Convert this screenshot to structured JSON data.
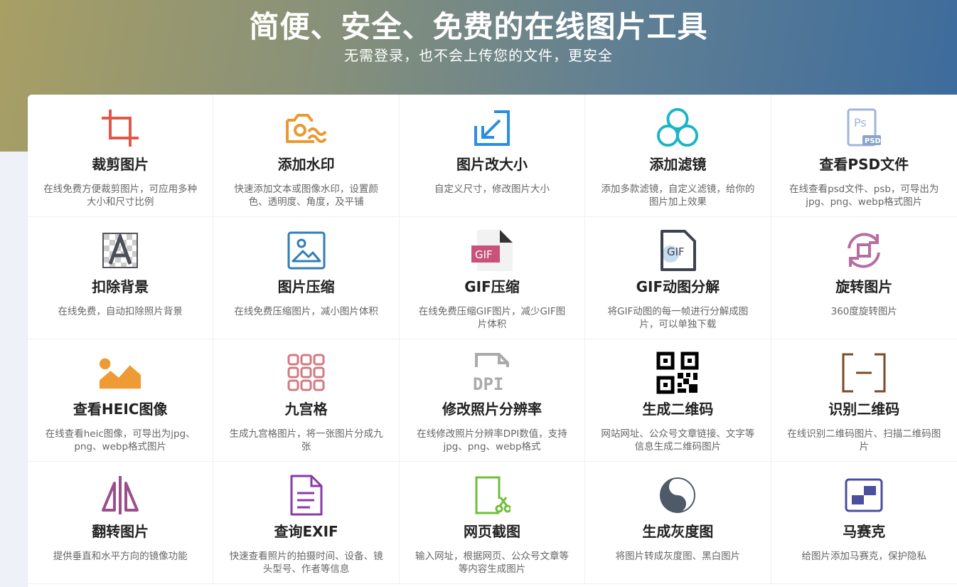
{
  "hero": {
    "title": "简便、安全、免费的在线图片工具",
    "subtitle": "无需登录，也不会上传您的文件，更安全"
  },
  "tools": [
    {
      "name": "crop",
      "icon": "crop-icon",
      "title": "裁剪图片",
      "desc": "在线免费方便裁剪图片，可应用多种大小和尺寸比例"
    },
    {
      "name": "watermark",
      "icon": "camera-watermark-icon",
      "title": "添加水印",
      "desc": "快速添加文本或图像水印，设置颜色、透明度、角度，及平铺"
    },
    {
      "name": "resize",
      "icon": "resize-arrow-icon",
      "title": "图片改大小",
      "desc": "自定义尺寸，修改图片大小"
    },
    {
      "name": "filter",
      "icon": "three-circles-filter-icon",
      "title": "添加滤镜",
      "desc": "添加多款滤镜，自定义滤镜，给你的图片加上效果"
    },
    {
      "name": "psd",
      "icon": "psd-file-icon",
      "title": "查看PSD文件",
      "desc": "在线查看psd文件、psb，可导出为jpg、png、webp格式图片"
    },
    {
      "name": "remove-bg",
      "icon": "letter-a-transparent-icon",
      "title": "扣除背景",
      "desc": "在线免费，自动扣除照片背景"
    },
    {
      "name": "compress",
      "icon": "image-frame-icon",
      "title": "图片压缩",
      "desc": "在线免费压缩图片，减小图片体积"
    },
    {
      "name": "gif-compress",
      "icon": "gif-file-icon",
      "title": "GIF压缩",
      "desc": "在线免费压缩GIF图片，减少GIF图片体积"
    },
    {
      "name": "gif-split",
      "icon": "gif-document-icon",
      "title": "GIF动图分解",
      "desc": "将GIF动图的每一帧进行分解成图片，可以单独下载"
    },
    {
      "name": "rotate",
      "icon": "rotate-arrows-icon",
      "title": "旋转图片",
      "desc": "360度旋转图片"
    },
    {
      "name": "heic",
      "icon": "landscape-sun-icon",
      "title": "查看HEIC图像",
      "desc": "在线查看heic图像，可导出为jpg、png、webp格式图片"
    },
    {
      "name": "nine-grid",
      "icon": "nine-grid-icon",
      "title": "九宫格",
      "desc": "生成九宫格图片，将一张图片分成九张"
    },
    {
      "name": "dpi",
      "icon": "dpi-file-icon",
      "title": "修改照片分辨率",
      "desc": "在线修改照片分辨率DPI数值，支持jpg、png、webp格式"
    },
    {
      "name": "qr-generate",
      "icon": "qr-code-icon",
      "title": "生成二维码",
      "desc": "网站网址、公众号文章链接、文字等信息生成二维码图片"
    },
    {
      "name": "qr-scan",
      "icon": "scan-bracket-icon",
      "title": "识别二维码",
      "desc": "在线识别二维码图片、扫描二维码图片"
    },
    {
      "name": "flip",
      "icon": "mirror-flip-icon",
      "title": "翻转图片",
      "desc": "提供垂直和水平方向的镜像功能"
    },
    {
      "name": "exif",
      "icon": "document-lines-icon",
      "title": "查询EXIF",
      "desc": "快速查看照片的拍摄时间、设备、镜头型号、作者等信息"
    },
    {
      "name": "screenshot",
      "icon": "scissors-page-icon",
      "title": "网页截图",
      "desc": "输入网址，根据网页、公众号文章等等内容生成图片"
    },
    {
      "name": "grayscale",
      "icon": "yin-yang-icon",
      "title": "生成灰度图",
      "desc": "将图片转成灰度图、黑白图片"
    },
    {
      "name": "mosaic",
      "icon": "mosaic-icon",
      "title": "马赛克",
      "desc": "给图片添加马赛克，保护隐私"
    }
  ]
}
